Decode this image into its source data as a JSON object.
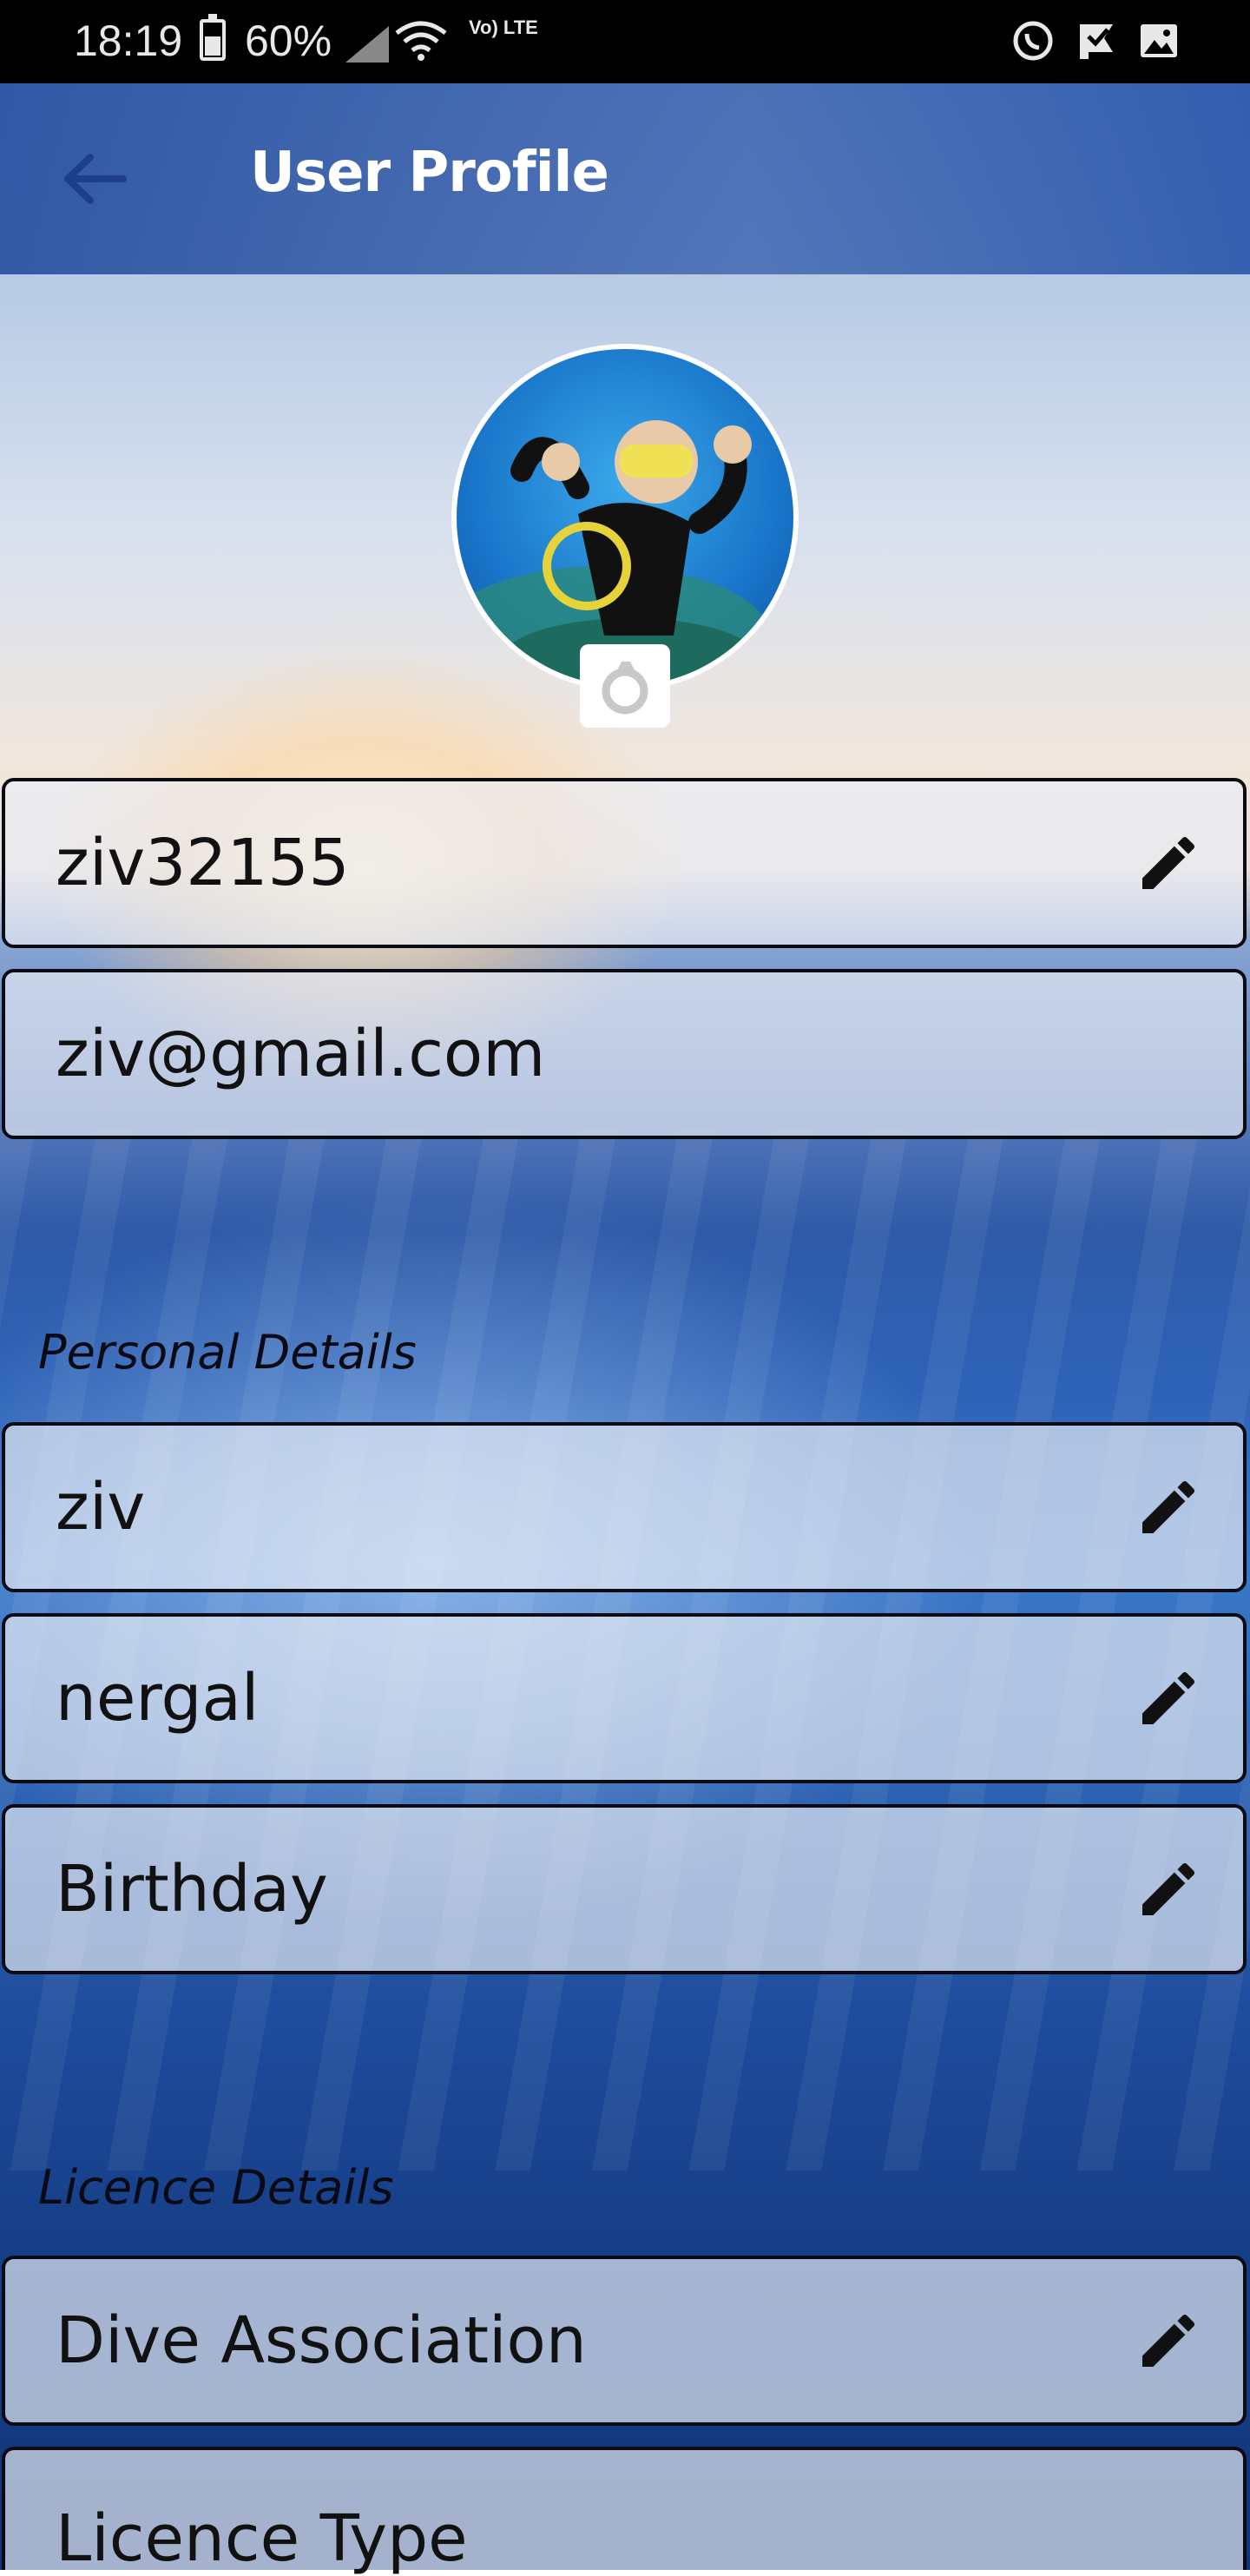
{
  "status_bar": {
    "time": "18:19",
    "battery": "60%",
    "network": "Vo) LTE"
  },
  "app_bar": {
    "title": "User Profile",
    "back_icon": "arrow-back-icon"
  },
  "avatar": {
    "description_icon": "avatar",
    "camera_icon": "camera-icon"
  },
  "fields": {
    "username": "ziv32155",
    "email": "ziv@gmail.com"
  },
  "sections": {
    "personal_details": "Personal Details",
    "licence_details": "Licence Details"
  },
  "personal": {
    "first_name": "ziv",
    "last_name": "nergal",
    "birthday": "Birthday"
  },
  "licence": {
    "dive_association": "Dive Association",
    "licence_type": "Licence Type"
  },
  "colors": {
    "app_bar": "#2f5aa8",
    "field_border": "#0b0b14",
    "title_text": "#ffffff"
  }
}
